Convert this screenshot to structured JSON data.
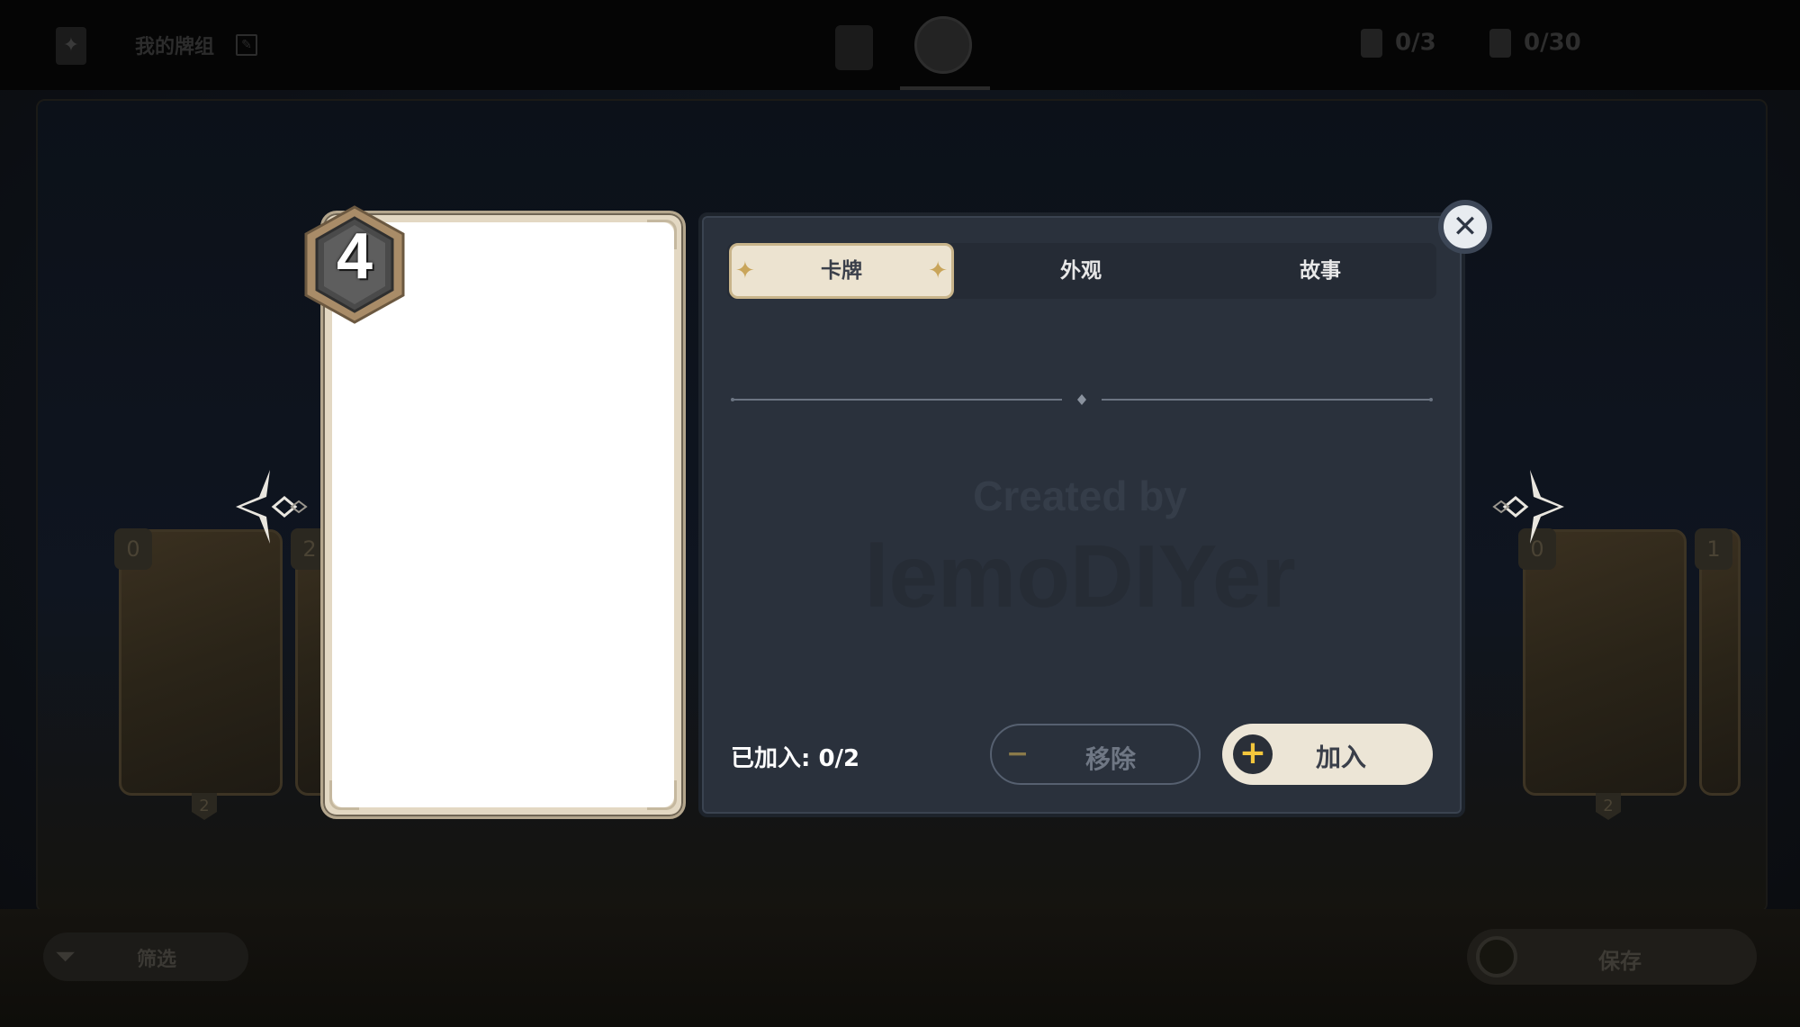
{
  "topbar": {
    "deck_name": "我的牌组",
    "character_count": "0/3",
    "action_count": "0/30"
  },
  "modal": {
    "cost": "4",
    "tabs": [
      {
        "label": "卡牌",
        "active": true
      },
      {
        "label": "外观",
        "active": false
      },
      {
        "label": "故事",
        "active": false
      }
    ],
    "watermark_line1": "Created by",
    "watermark_line2": "lemoDIYer",
    "added_text": "已加入: 0/2",
    "remove_label": "移除",
    "add_label": "加入",
    "close_symbol": "✕",
    "remove_symbol": "−",
    "add_symbol": "+"
  },
  "background_cards": [
    {
      "cost": "0",
      "count": "2"
    },
    {
      "cost": "2",
      "count": ""
    },
    {
      "cost": "0",
      "count": "2"
    },
    {
      "cost": "1",
      "count": ""
    }
  ],
  "bottombar": {
    "filter_label": "筛选",
    "save_label": "保存"
  },
  "colors": {
    "panel": "#2a313c",
    "tab_active": "#ece3d0",
    "add_button": "#ece5d6",
    "plus_icon": "#f3c63c"
  }
}
